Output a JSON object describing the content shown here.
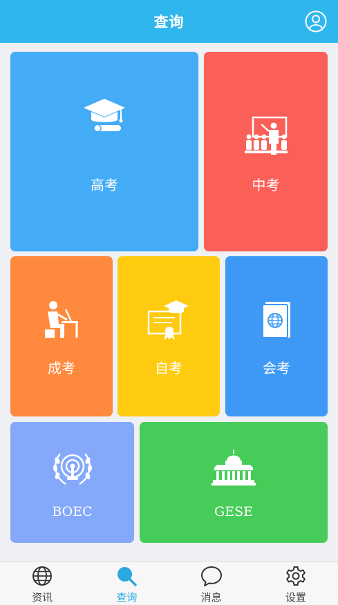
{
  "header": {
    "title": "查询",
    "profile_icon": "user-circle-icon"
  },
  "tiles": [
    {
      "key": "gaokao",
      "label": "高考",
      "color": "#44acf6",
      "icon": "graduation-cap-icon"
    },
    {
      "key": "zhongkao",
      "label": "中考",
      "color": "#fa6058",
      "icon": "teacher-board-icon"
    },
    {
      "key": "chengkao",
      "label": "成考",
      "color": "#ff8a3d",
      "icon": "student-desk-icon"
    },
    {
      "key": "zikao",
      "label": "自考",
      "color": "#ffcb11",
      "icon": "certificate-icon"
    },
    {
      "key": "huikao",
      "label": "会考",
      "color": "#3d99f5",
      "icon": "passport-icon"
    },
    {
      "key": "boec",
      "label": "BOEC",
      "color": "#84a8fa",
      "icon": "laurel-emblem-icon"
    },
    {
      "key": "gese",
      "label": "GESE",
      "color": "#46cc58",
      "icon": "capitol-building-icon"
    }
  ],
  "tabbar": {
    "active_color": "#2aa8e2",
    "items": [
      {
        "label": "资讯",
        "icon": "globe-icon",
        "active": false
      },
      {
        "label": "查询",
        "icon": "search-icon",
        "active": true
      },
      {
        "label": "消息",
        "icon": "chat-bubble-icon",
        "active": false
      },
      {
        "label": "设置",
        "icon": "gear-icon",
        "active": false
      }
    ]
  }
}
